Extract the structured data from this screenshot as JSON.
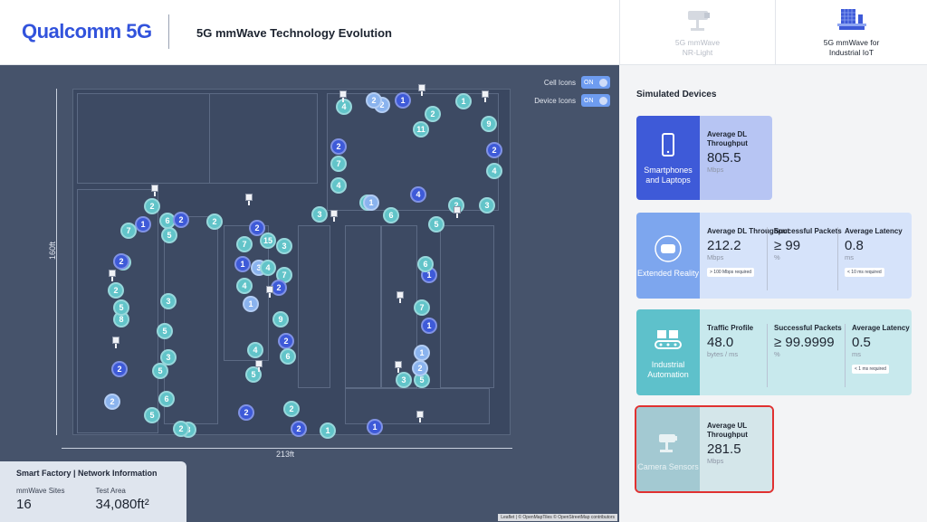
{
  "header": {
    "logo": "Qualcomm 5G",
    "title": "5G mmWave Technology Evolution",
    "tabs": [
      {
        "label": "5G mmWave\nNR-Light",
        "active": false
      },
      {
        "label": "5G mmWave for\nIndustrial IoT",
        "active": true
      }
    ]
  },
  "map": {
    "dim_height": "160ft",
    "dim_width": "213ft",
    "toggles": [
      {
        "label": "Cell Icons",
        "state": "ON"
      },
      {
        "label": "Device Icons",
        "state": "ON"
      }
    ],
    "markers": [
      {
        "n": "4",
        "c": "teal"
      },
      {
        "n": "2",
        "c": "light"
      },
      {
        "n": "1",
        "c": "blue"
      },
      {
        "n": "2",
        "c": "light"
      },
      {
        "n": "1",
        "c": "teal"
      },
      {
        "n": "9",
        "c": "teal"
      },
      {
        "n": "2",
        "c": "teal"
      },
      {
        "n": "11",
        "c": "teal"
      },
      {
        "n": "2",
        "c": "blue"
      },
      {
        "n": "7",
        "c": "teal"
      },
      {
        "n": "2",
        "c": "blue"
      },
      {
        "n": "4",
        "c": "teal"
      },
      {
        "n": "4",
        "c": "teal"
      },
      {
        "n": "4",
        "c": "blue"
      },
      {
        "n": "1",
        "c": "teal"
      },
      {
        "n": "2",
        "c": "teal"
      },
      {
        "n": "1",
        "c": "light"
      },
      {
        "n": "6",
        "c": "teal"
      },
      {
        "n": "3",
        "c": "teal"
      },
      {
        "n": "3",
        "c": "teal"
      },
      {
        "n": "5",
        "c": "teal"
      },
      {
        "n": "2",
        "c": "teal"
      },
      {
        "n": "1",
        "c": "blue"
      },
      {
        "n": "6",
        "c": "teal"
      },
      {
        "n": "2",
        "c": "blue"
      },
      {
        "n": "2",
        "c": "teal"
      },
      {
        "n": "7",
        "c": "teal"
      },
      {
        "n": "5",
        "c": "teal"
      },
      {
        "n": "2",
        "c": "blue"
      },
      {
        "n": "7",
        "c": "teal"
      },
      {
        "n": "15",
        "c": "teal"
      },
      {
        "n": "3",
        "c": "teal"
      },
      {
        "n": "2",
        "c": "teal"
      },
      {
        "n": "2",
        "c": "blue"
      },
      {
        "n": "1",
        "c": "blue"
      },
      {
        "n": "3",
        "c": "light"
      },
      {
        "n": "4",
        "c": "teal"
      },
      {
        "n": "7",
        "c": "teal"
      },
      {
        "n": "2",
        "c": "teal"
      },
      {
        "n": "4",
        "c": "teal"
      },
      {
        "n": "2",
        "c": "blue"
      },
      {
        "n": "1",
        "c": "light"
      },
      {
        "n": "3",
        "c": "teal"
      },
      {
        "n": "8",
        "c": "teal"
      },
      {
        "n": "9",
        "c": "teal"
      },
      {
        "n": "5",
        "c": "teal"
      },
      {
        "n": "2",
        "c": "blue"
      },
      {
        "n": "4",
        "c": "teal"
      },
      {
        "n": "6",
        "c": "teal"
      },
      {
        "n": "2",
        "c": "blue"
      },
      {
        "n": "5",
        "c": "teal"
      },
      {
        "n": "5",
        "c": "teal"
      },
      {
        "n": "1",
        "c": "light"
      },
      {
        "n": "6",
        "c": "teal"
      },
      {
        "n": "5",
        "c": "teal"
      },
      {
        "n": "3",
        "c": "teal"
      },
      {
        "n": "2",
        "c": "blue"
      },
      {
        "n": "2",
        "c": "light"
      },
      {
        "n": "2",
        "c": "teal"
      },
      {
        "n": "2",
        "c": "blue"
      },
      {
        "n": "1",
        "c": "teal"
      },
      {
        "n": "1",
        "c": "blue"
      },
      {
        "n": "5",
        "c": "teal"
      },
      {
        "n": "3",
        "c": "teal"
      },
      {
        "n": "2",
        "c": "teal"
      },
      {
        "n": "7",
        "c": "teal"
      },
      {
        "n": "1",
        "c": "blue"
      },
      {
        "n": "6",
        "c": "teal"
      },
      {
        "n": "1",
        "c": "blue"
      },
      {
        "n": "5",
        "c": "teal"
      },
      {
        "n": "3",
        "c": "teal"
      },
      {
        "n": "2",
        "c": "light"
      }
    ],
    "cell_count": 14,
    "info": {
      "title": "Smart Factory | Network Information",
      "sites_label": "mmWave Sites",
      "sites_value": "16",
      "area_label": "Test Area",
      "area_value": "34,080ft²"
    },
    "attribution": "Leaflet | © OpenMapTiles © OpenStreetMap contributors"
  },
  "panel": {
    "title": "Simulated Devices",
    "cards": [
      {
        "name": "Smartphones and Laptops",
        "icon": "smartphone-icon",
        "metrics": [
          {
            "label": "Average DL Throughput",
            "value": "805.5",
            "unit": "Mbps"
          }
        ]
      },
      {
        "name": "Extended Reality",
        "icon": "vr-headset-icon",
        "metrics": [
          {
            "label": "Average DL Throughput",
            "value": "212.2",
            "unit": "Mbps",
            "note": "> 100 Mbps required"
          },
          {
            "label": "Successful Packets",
            "value": "≥ 99",
            "unit": "%"
          },
          {
            "label": "Average Latency",
            "value": "0.8",
            "unit": "ms",
            "note": "< 10 ms required"
          }
        ]
      },
      {
        "name": "Industrial Automation",
        "icon": "conveyor-icon",
        "metrics": [
          {
            "label": "Traffic Profile",
            "value": "48.0",
            "unit": "bytes / ms"
          },
          {
            "label": "Successful Packets",
            "value": "≥ 99.9999",
            "unit": "%"
          },
          {
            "label": "Average Latency",
            "value": "0.5",
            "unit": "ms",
            "note": "< 1 ms required"
          }
        ]
      },
      {
        "name": "Camera Sensors",
        "icon": "security-camera-icon",
        "highlighted": true,
        "metrics": [
          {
            "label": "Average UL Throughput",
            "value": "281.5",
            "unit": "Mbps"
          }
        ]
      }
    ]
  }
}
